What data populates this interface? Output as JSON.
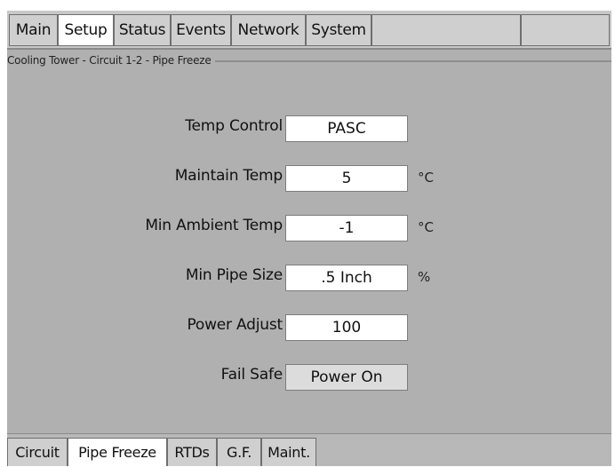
{
  "top_tabs": [
    {
      "label": "Main"
    },
    {
      "label": "Setup"
    },
    {
      "label": "Status"
    },
    {
      "label": "Events"
    },
    {
      "label": "Network"
    },
    {
      "label": "System"
    }
  ],
  "active_top_tab": "Setup",
  "group_title": "Cooling Tower - Circuit 1-2 - Pipe Freeze",
  "fields": {
    "temp_control": {
      "label": "Temp Control",
      "value": "PASC"
    },
    "maintain_temp": {
      "label": "Maintain Temp",
      "value": "5",
      "unit": "°C"
    },
    "min_ambient_temp": {
      "label": "Min Ambient Temp",
      "value": "-1",
      "unit": "°C"
    },
    "min_pipe_size": {
      "label": "Min Pipe Size",
      "value": ".5 Inch",
      "unit": "%"
    },
    "power_adjust": {
      "label": "Power Adjust",
      "value": "100"
    },
    "fail_safe": {
      "label": "Fail Safe",
      "value": "Power On"
    }
  },
  "bottom_tabs": [
    {
      "label": "Circuit"
    },
    {
      "label": "Pipe Freeze"
    },
    {
      "label": "RTDs"
    },
    {
      "label": "G.F."
    },
    {
      "label": "Maint."
    }
  ],
  "active_bottom_tab": "Pipe Freeze"
}
